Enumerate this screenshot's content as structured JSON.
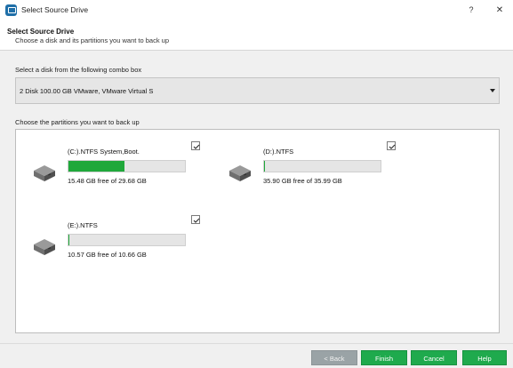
{
  "window": {
    "title": "Select Source Drive",
    "help_glyph": "?",
    "close_glyph": "✕"
  },
  "header": {
    "title": "Select Source Drive",
    "subtitle": "Choose a disk and its partitions you want to back up"
  },
  "disk_select": {
    "label": "Select a disk from the following combo box",
    "value": "2 Disk 100.00 GB VMware,  VMware Virtual S"
  },
  "partitions_section": {
    "label": "Choose the partitions you want to back up",
    "partitions": [
      {
        "name": "(C:).NTFS System,Boot.",
        "free_text": "15.48 GB free of 29.68 GB",
        "used_fraction": 0.48,
        "checked": true
      },
      {
        "name": "(D:).NTFS",
        "free_text": "35.90 GB free of 35.99 GB",
        "used_fraction": 0.003,
        "checked": true
      },
      {
        "name": "(E:).NTFS",
        "free_text": "10.57 GB free of 10.66 GB",
        "used_fraction": 0.008,
        "checked": true
      }
    ]
  },
  "buttons": {
    "back": "< Back",
    "finish": "Finish",
    "cancel": "Cancel",
    "help": "Help"
  },
  "colors": {
    "usage_bar": "#1fa83a",
    "accent_button": "#1faa4d",
    "disabled_button": "#9aa3a6"
  },
  "icons": {
    "app": "backup-app-icon",
    "drive": "hard-drive-icon",
    "checkbox": "checkmark-icon",
    "combo": "dropdown-arrow-icon"
  }
}
